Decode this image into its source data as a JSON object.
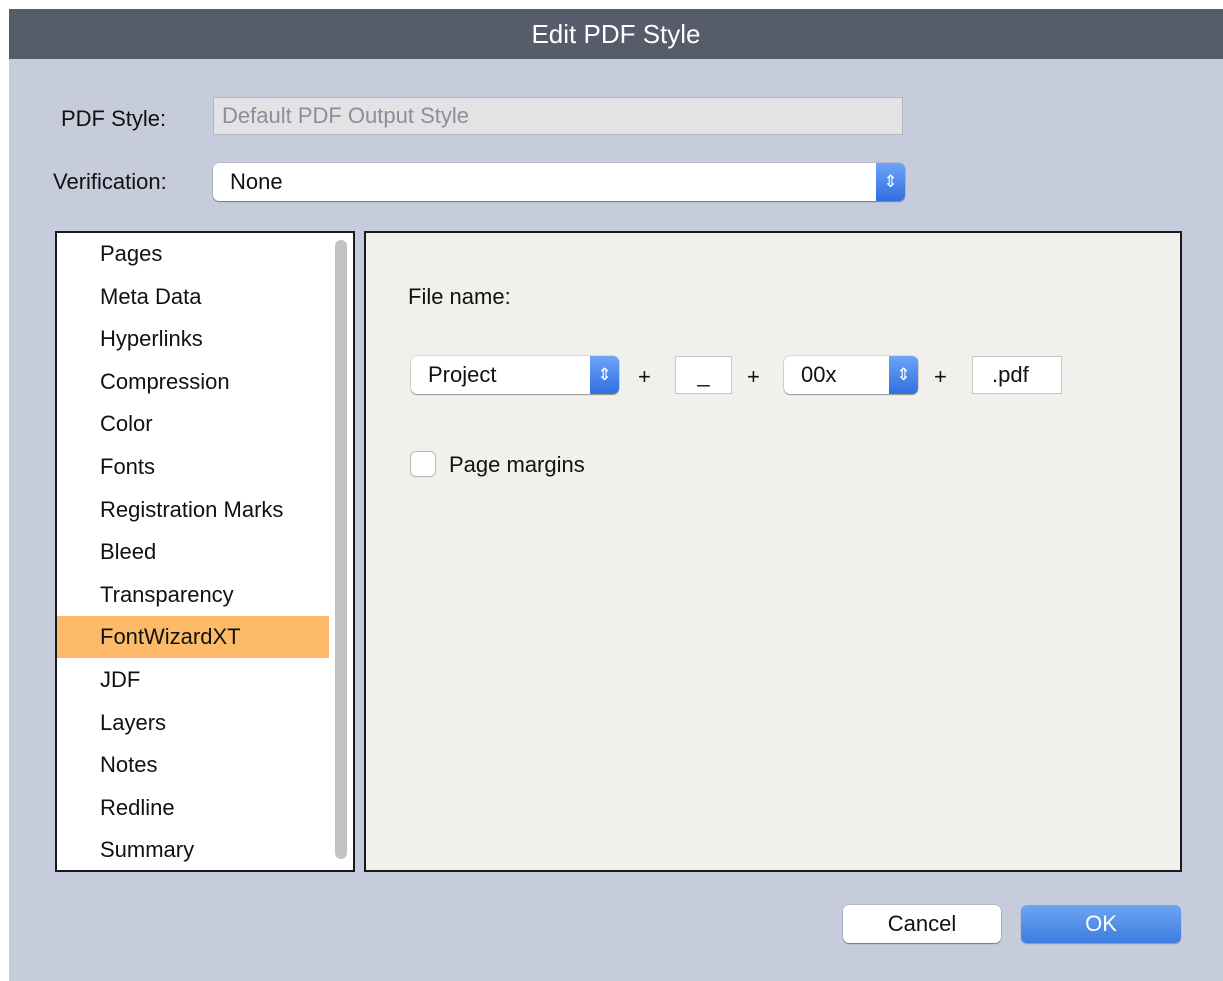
{
  "window": {
    "title": "Edit PDF Style"
  },
  "form": {
    "pdf_style_label": "PDF Style:",
    "pdf_style_value": "Default PDF Output Style",
    "verification_label": "Verification:",
    "verification_value": "None"
  },
  "sidebar": {
    "items": [
      {
        "label": "Pages"
      },
      {
        "label": "Meta Data"
      },
      {
        "label": "Hyperlinks"
      },
      {
        "label": "Compression"
      },
      {
        "label": "Color"
      },
      {
        "label": "Fonts"
      },
      {
        "label": "Registration Marks"
      },
      {
        "label": "Bleed"
      },
      {
        "label": "Transparency"
      },
      {
        "label": "FontWizardXT"
      },
      {
        "label": "JDF"
      },
      {
        "label": "Layers"
      },
      {
        "label": "Notes"
      },
      {
        "label": "Redline"
      },
      {
        "label": "Summary"
      }
    ],
    "selected": "FontWizardXT"
  },
  "content": {
    "file_name_label": "File name:",
    "name_source_value": "Project",
    "plus1": "+",
    "separator_value": "_",
    "plus2": "+",
    "numbering_value": "00x",
    "plus3": "+",
    "extension_value": ".pdf",
    "page_margins_label": "Page margins",
    "page_margins_checked": false
  },
  "buttons": {
    "cancel": "Cancel",
    "ok": "OK"
  },
  "icons": {
    "popup_arrows": "up-down-chevrons-icon"
  },
  "colors": {
    "selection": "#fdbb69",
    "accent_blue": "#3d7ddf",
    "titlebar": "#565c69",
    "dialog_bg": "#c6ccdb"
  }
}
